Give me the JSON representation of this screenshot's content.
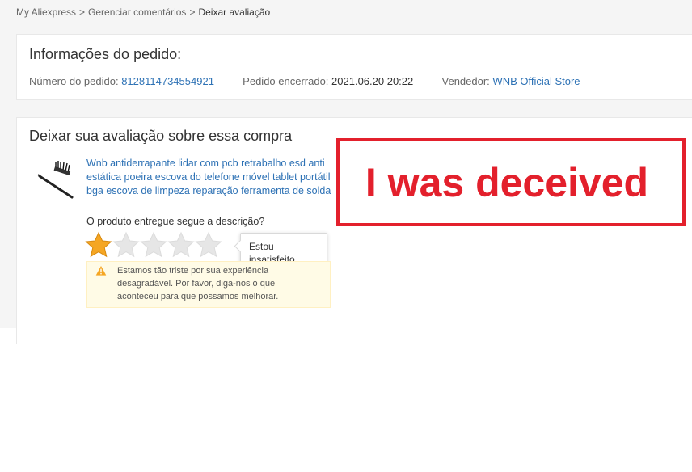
{
  "breadcrumb": {
    "items": [
      "My Aliexpress",
      "Gerenciar comentários"
    ],
    "separator": ">",
    "current": "Deixar avaliação"
  },
  "order_info": {
    "title": "Informações do pedido:",
    "order_number_label": "Número do pedido:",
    "order_number": "8128114734554921",
    "closed_label": "Pedido encerrado:",
    "closed_date": "2021.06.20 20:22",
    "seller_label": "Vendedor:",
    "seller_name": "WNB Official Store"
  },
  "review": {
    "title": "Deixar sua avaliação sobre essa compra",
    "product_title": "Wnb antiderrapante lidar com pcb retrabalho esd anti estática poeira escova do telefone móvel tablet portátil bga escova de limpeza reparação ferramenta de solda",
    "question": "O produto entregue segue a descrição?",
    "rating": 1,
    "max_rating": 5,
    "star_active_color": "#f5a623",
    "star_inactive_color": "#e6e6e6",
    "tooltip_line1": "Estou",
    "tooltip_line2": "insatisfeito",
    "warning_text": "Estamos tão triste por sua experiência desagradável. Por favor, diga-nos o que aconteceu para que possamos melhorar.",
    "warning_icon": "warning-triangle-icon"
  },
  "annotation": {
    "text": "I was deceived",
    "color": "#e3202c"
  }
}
